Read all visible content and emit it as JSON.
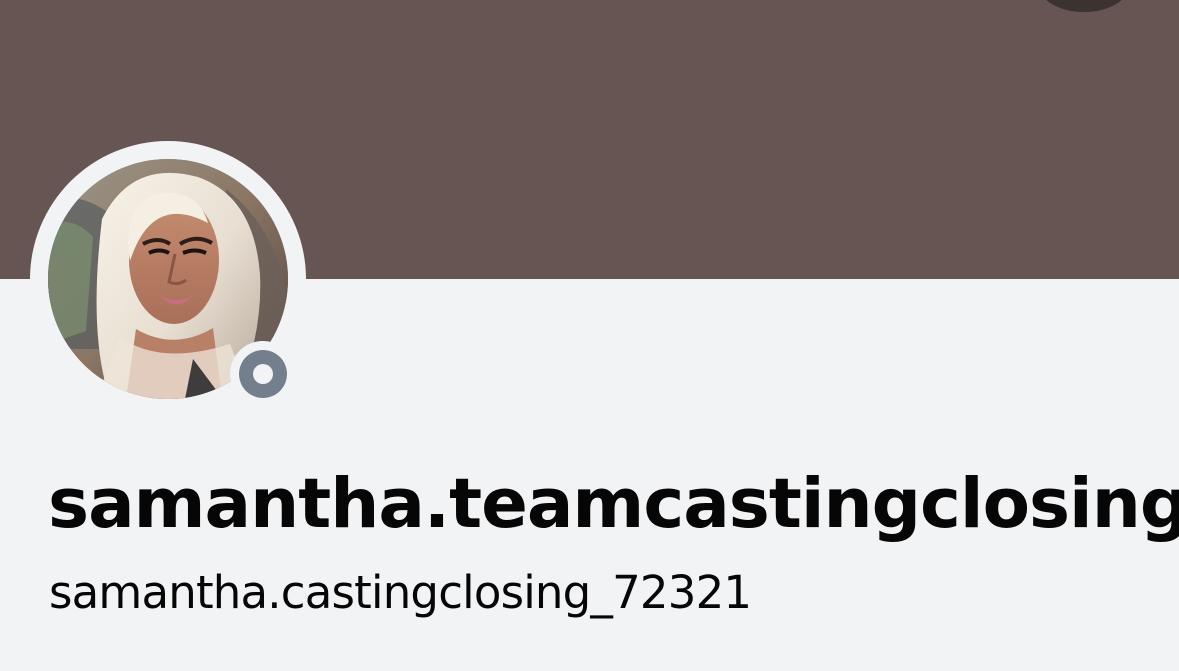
{
  "profile": {
    "display_name": "samantha.teamcastingclosing",
    "username": "samantha.castingclosing_72321",
    "status": "offline"
  },
  "colors": {
    "banner": "#665552",
    "background": "#f2f3f5",
    "status_offline": "#747f8d",
    "text": "#060607"
  },
  "icons": {
    "avatar": "user-avatar-photo",
    "status": "offline-status-icon",
    "corner": "round-header-button"
  }
}
